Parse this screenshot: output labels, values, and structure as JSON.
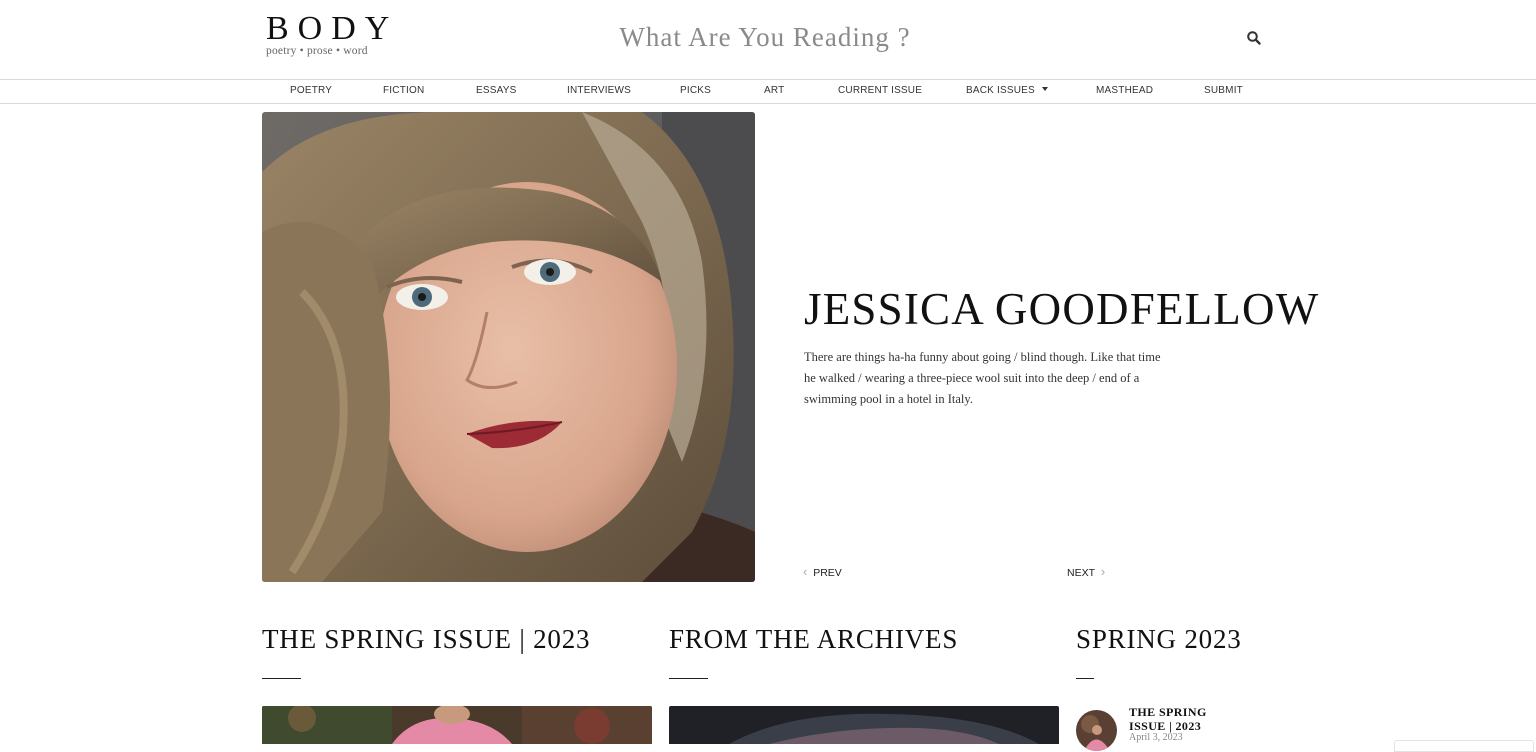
{
  "site": {
    "logo_main": "BODY",
    "logo_sub": "poetry • prose • word",
    "tagline": "What Are You Reading ?"
  },
  "nav": {
    "items": [
      "POETRY",
      "FICTION",
      "ESSAYS",
      "INTERVIEWS",
      "PICKS",
      "ART",
      "CURRENT ISSUE",
      "BACK ISSUES",
      "MASTHEAD",
      "SUBMIT"
    ]
  },
  "hero": {
    "title": "JESSICA GOODFELLOW",
    "excerpt": "There are things ha-ha funny about going / blind though. Like that time he walked / wearing a three-piece wool suit into the deep / end of a swimming pool in a hotel in Italy.",
    "prev_label": "PREV",
    "next_label": "NEXT"
  },
  "sections": {
    "spring_issue_title": "THE SPRING ISSUE | 2023",
    "archives_title": "FROM THE ARCHIVES",
    "spring_sidebar_title": "SPRING 2023"
  },
  "sidebar_post": {
    "title": "THE SPRING ISSUE | 2023",
    "date": "April 3, 2023"
  },
  "colors": {
    "text": "#111111",
    "muted": "#8a8a8a",
    "divider": "#d9d9d9"
  }
}
